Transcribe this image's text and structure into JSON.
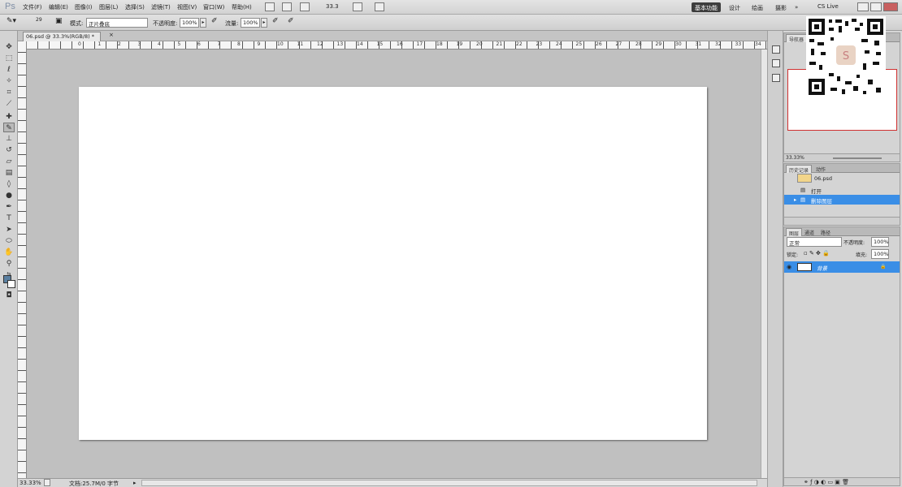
{
  "app": {
    "logo": "Ps"
  },
  "menu": [
    "文件(F)",
    "编辑(E)",
    "图像(I)",
    "图层(L)",
    "选择(S)",
    "滤镜(T)",
    "视图(V)",
    "窗口(W)",
    "帮助(H)"
  ],
  "menubar": {
    "zoom_value": "33.3",
    "cs_live": "CS Live"
  },
  "workspaces": [
    "基本功能",
    "设计",
    "绘画",
    "摄影"
  ],
  "overflow_label": "»",
  "options": {
    "brush_size": "29",
    "mode_label": "模式:",
    "mode_value": "正片叠底",
    "opacity_label": "不透明度:",
    "opacity_value": "100%",
    "flow_label": "流量:",
    "flow_value": "100%"
  },
  "document": {
    "tab_title": "06.psd @ 33.3%(RGB/8) *",
    "close": "×"
  },
  "ruler_labels": [
    "0",
    "1",
    "2",
    "3",
    "4",
    "5",
    "6",
    "7",
    "8",
    "9",
    "10",
    "11",
    "12",
    "13",
    "14",
    "15",
    "16",
    "17",
    "18",
    "19",
    "20",
    "21",
    "22",
    "23",
    "24",
    "25",
    "26",
    "27",
    "28",
    "29",
    "30",
    "31",
    "32",
    "33",
    "34",
    "35",
    "36"
  ],
  "status": {
    "zoom": "33.33%",
    "doc_info": "文档:25.7M/0 字节"
  },
  "navigator": {
    "tab": "导航器",
    "zoom": "33.33%"
  },
  "history": {
    "tabs": [
      "历史记录",
      "动作"
    ],
    "snapshot": "06.psd",
    "items": [
      "打开",
      "删除图层"
    ],
    "selected_index": 1
  },
  "layers": {
    "tabs": [
      "图层",
      "通道",
      "路径"
    ],
    "blend_mode": "正常",
    "opacity_label": "不透明度:",
    "opacity_value": "100%",
    "lock_label": "锁定:",
    "fill_label": "填充:",
    "fill_value": "100%",
    "rows": [
      {
        "name": "背景",
        "selected": true
      }
    ]
  },
  "colors": {
    "accent": "#3a8ee6",
    "workspace": "#c0c0c0",
    "canvas": "#ffffff"
  }
}
